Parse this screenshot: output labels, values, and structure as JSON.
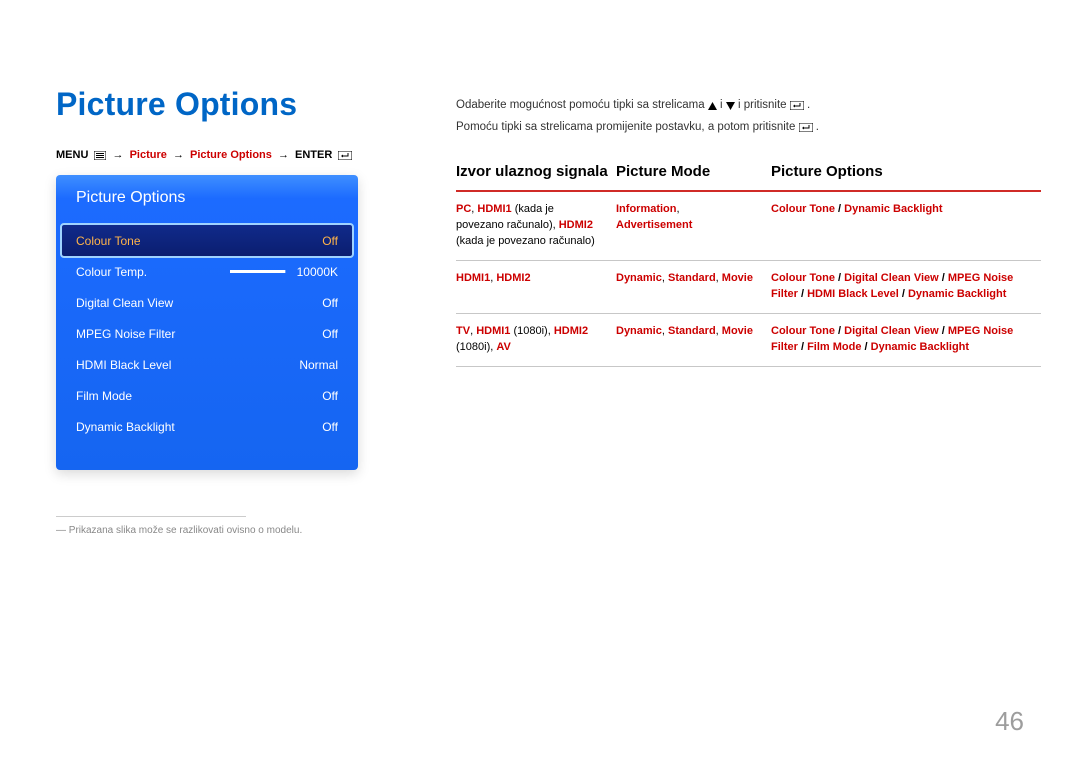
{
  "title": "Picture Options",
  "breadcrumb": {
    "menu": "MENU",
    "picture": "Picture",
    "picture_options": "Picture Options",
    "enter": "ENTER"
  },
  "panel": {
    "header": "Picture Options",
    "rows": [
      {
        "label": "Colour Tone",
        "value": "Off",
        "selected": true
      },
      {
        "label": "Colour Temp.",
        "value": "10000K",
        "slider": true
      },
      {
        "label": "Digital Clean View",
        "value": "Off"
      },
      {
        "label": "MPEG Noise Filter",
        "value": "Off"
      },
      {
        "label": "HDMI Black Level",
        "value": "Normal"
      },
      {
        "label": "Film Mode",
        "value": "Off"
      },
      {
        "label": "Dynamic Backlight",
        "value": "Off"
      }
    ]
  },
  "footnote": "― Prikazana slika može se razlikovati ovisno o modelu.",
  "instructions": {
    "l1a": "Odaberite mogućnost pomoću tipki sa strelicama ",
    "l1b": " i ",
    "l1c": " i pritisnite ",
    "l1d": ".",
    "l2a": "Pomoću tipki sa strelicama promijenite postavku, a potom pritisnite ",
    "l2b": "."
  },
  "table": {
    "head": {
      "c1": "Izvor ulaznog signala",
      "c2": "Picture Mode",
      "c3": "Picture Options"
    },
    "rows": [
      {
        "c1": [
          {
            "txt": "PC",
            "cls": "b r"
          },
          {
            "txt": ", ",
            "cls": "blk"
          },
          {
            "txt": "HDMI1",
            "cls": "b r"
          },
          {
            "txt": " (kada je povezano računalo), ",
            "cls": "blk"
          },
          {
            "txt": "HDMI2",
            "cls": "b r"
          },
          {
            "txt": " (kada je povezano računalo)",
            "cls": "blk"
          }
        ],
        "c2": [
          {
            "txt": "Information",
            "cls": "b r"
          },
          {
            "txt": ", ",
            "cls": "blk"
          },
          {
            "txt": "Advertisement",
            "cls": "b r"
          }
        ],
        "c3": [
          {
            "txt": "Colour Tone",
            "cls": "b r"
          },
          {
            "txt": " / ",
            "cls": "sep"
          },
          {
            "txt": "Dynamic Backlight",
            "cls": "b r"
          }
        ]
      },
      {
        "c1": [
          {
            "txt": "HDMI1",
            "cls": "b r"
          },
          {
            "txt": ", ",
            "cls": "blk"
          },
          {
            "txt": "HDMI2",
            "cls": "b r"
          }
        ],
        "c2": [
          {
            "txt": "Dynamic",
            "cls": "b r"
          },
          {
            "txt": ", ",
            "cls": "blk"
          },
          {
            "txt": "Standard",
            "cls": "b r"
          },
          {
            "txt": ", ",
            "cls": "blk"
          },
          {
            "txt": "Movie",
            "cls": "b r"
          }
        ],
        "c3": [
          {
            "txt": "Colour Tone",
            "cls": "b r"
          },
          {
            "txt": " / ",
            "cls": "sep"
          },
          {
            "txt": "Digital Clean View",
            "cls": "b r"
          },
          {
            "txt": " / ",
            "cls": "sep"
          },
          {
            "txt": "MPEG Noise Filter",
            "cls": "b r"
          },
          {
            "txt": " / ",
            "cls": "sep"
          },
          {
            "txt": "HDMI Black Level",
            "cls": "b r"
          },
          {
            "txt": " / ",
            "cls": "sep"
          },
          {
            "txt": "Dynamic Backlight",
            "cls": "b r"
          }
        ]
      },
      {
        "c1": [
          {
            "txt": "TV",
            "cls": "b r"
          },
          {
            "txt": ", ",
            "cls": "blk"
          },
          {
            "txt": "HDMI1",
            "cls": "b r"
          },
          {
            "txt": " (1080i), ",
            "cls": "blk"
          },
          {
            "txt": "HDMI2",
            "cls": "b r"
          },
          {
            "txt": " (1080i), ",
            "cls": "blk"
          },
          {
            "txt": "AV",
            "cls": "b r"
          }
        ],
        "c2": [
          {
            "txt": "Dynamic",
            "cls": "b r"
          },
          {
            "txt": ", ",
            "cls": "blk"
          },
          {
            "txt": "Standard",
            "cls": "b r"
          },
          {
            "txt": ", ",
            "cls": "blk"
          },
          {
            "txt": "Movie",
            "cls": "b r"
          }
        ],
        "c3": [
          {
            "txt": "Colour Tone",
            "cls": "b r"
          },
          {
            "txt": " / ",
            "cls": "sep"
          },
          {
            "txt": "Digital Clean View",
            "cls": "b r"
          },
          {
            "txt": " / ",
            "cls": "sep"
          },
          {
            "txt": "MPEG Noise Filter",
            "cls": "b r"
          },
          {
            "txt": " / ",
            "cls": "sep"
          },
          {
            "txt": "Film Mode",
            "cls": "b r"
          },
          {
            "txt": " / ",
            "cls": "sep"
          },
          {
            "txt": "Dynamic Backlight",
            "cls": "b r"
          }
        ]
      }
    ]
  },
  "page_number": "46"
}
